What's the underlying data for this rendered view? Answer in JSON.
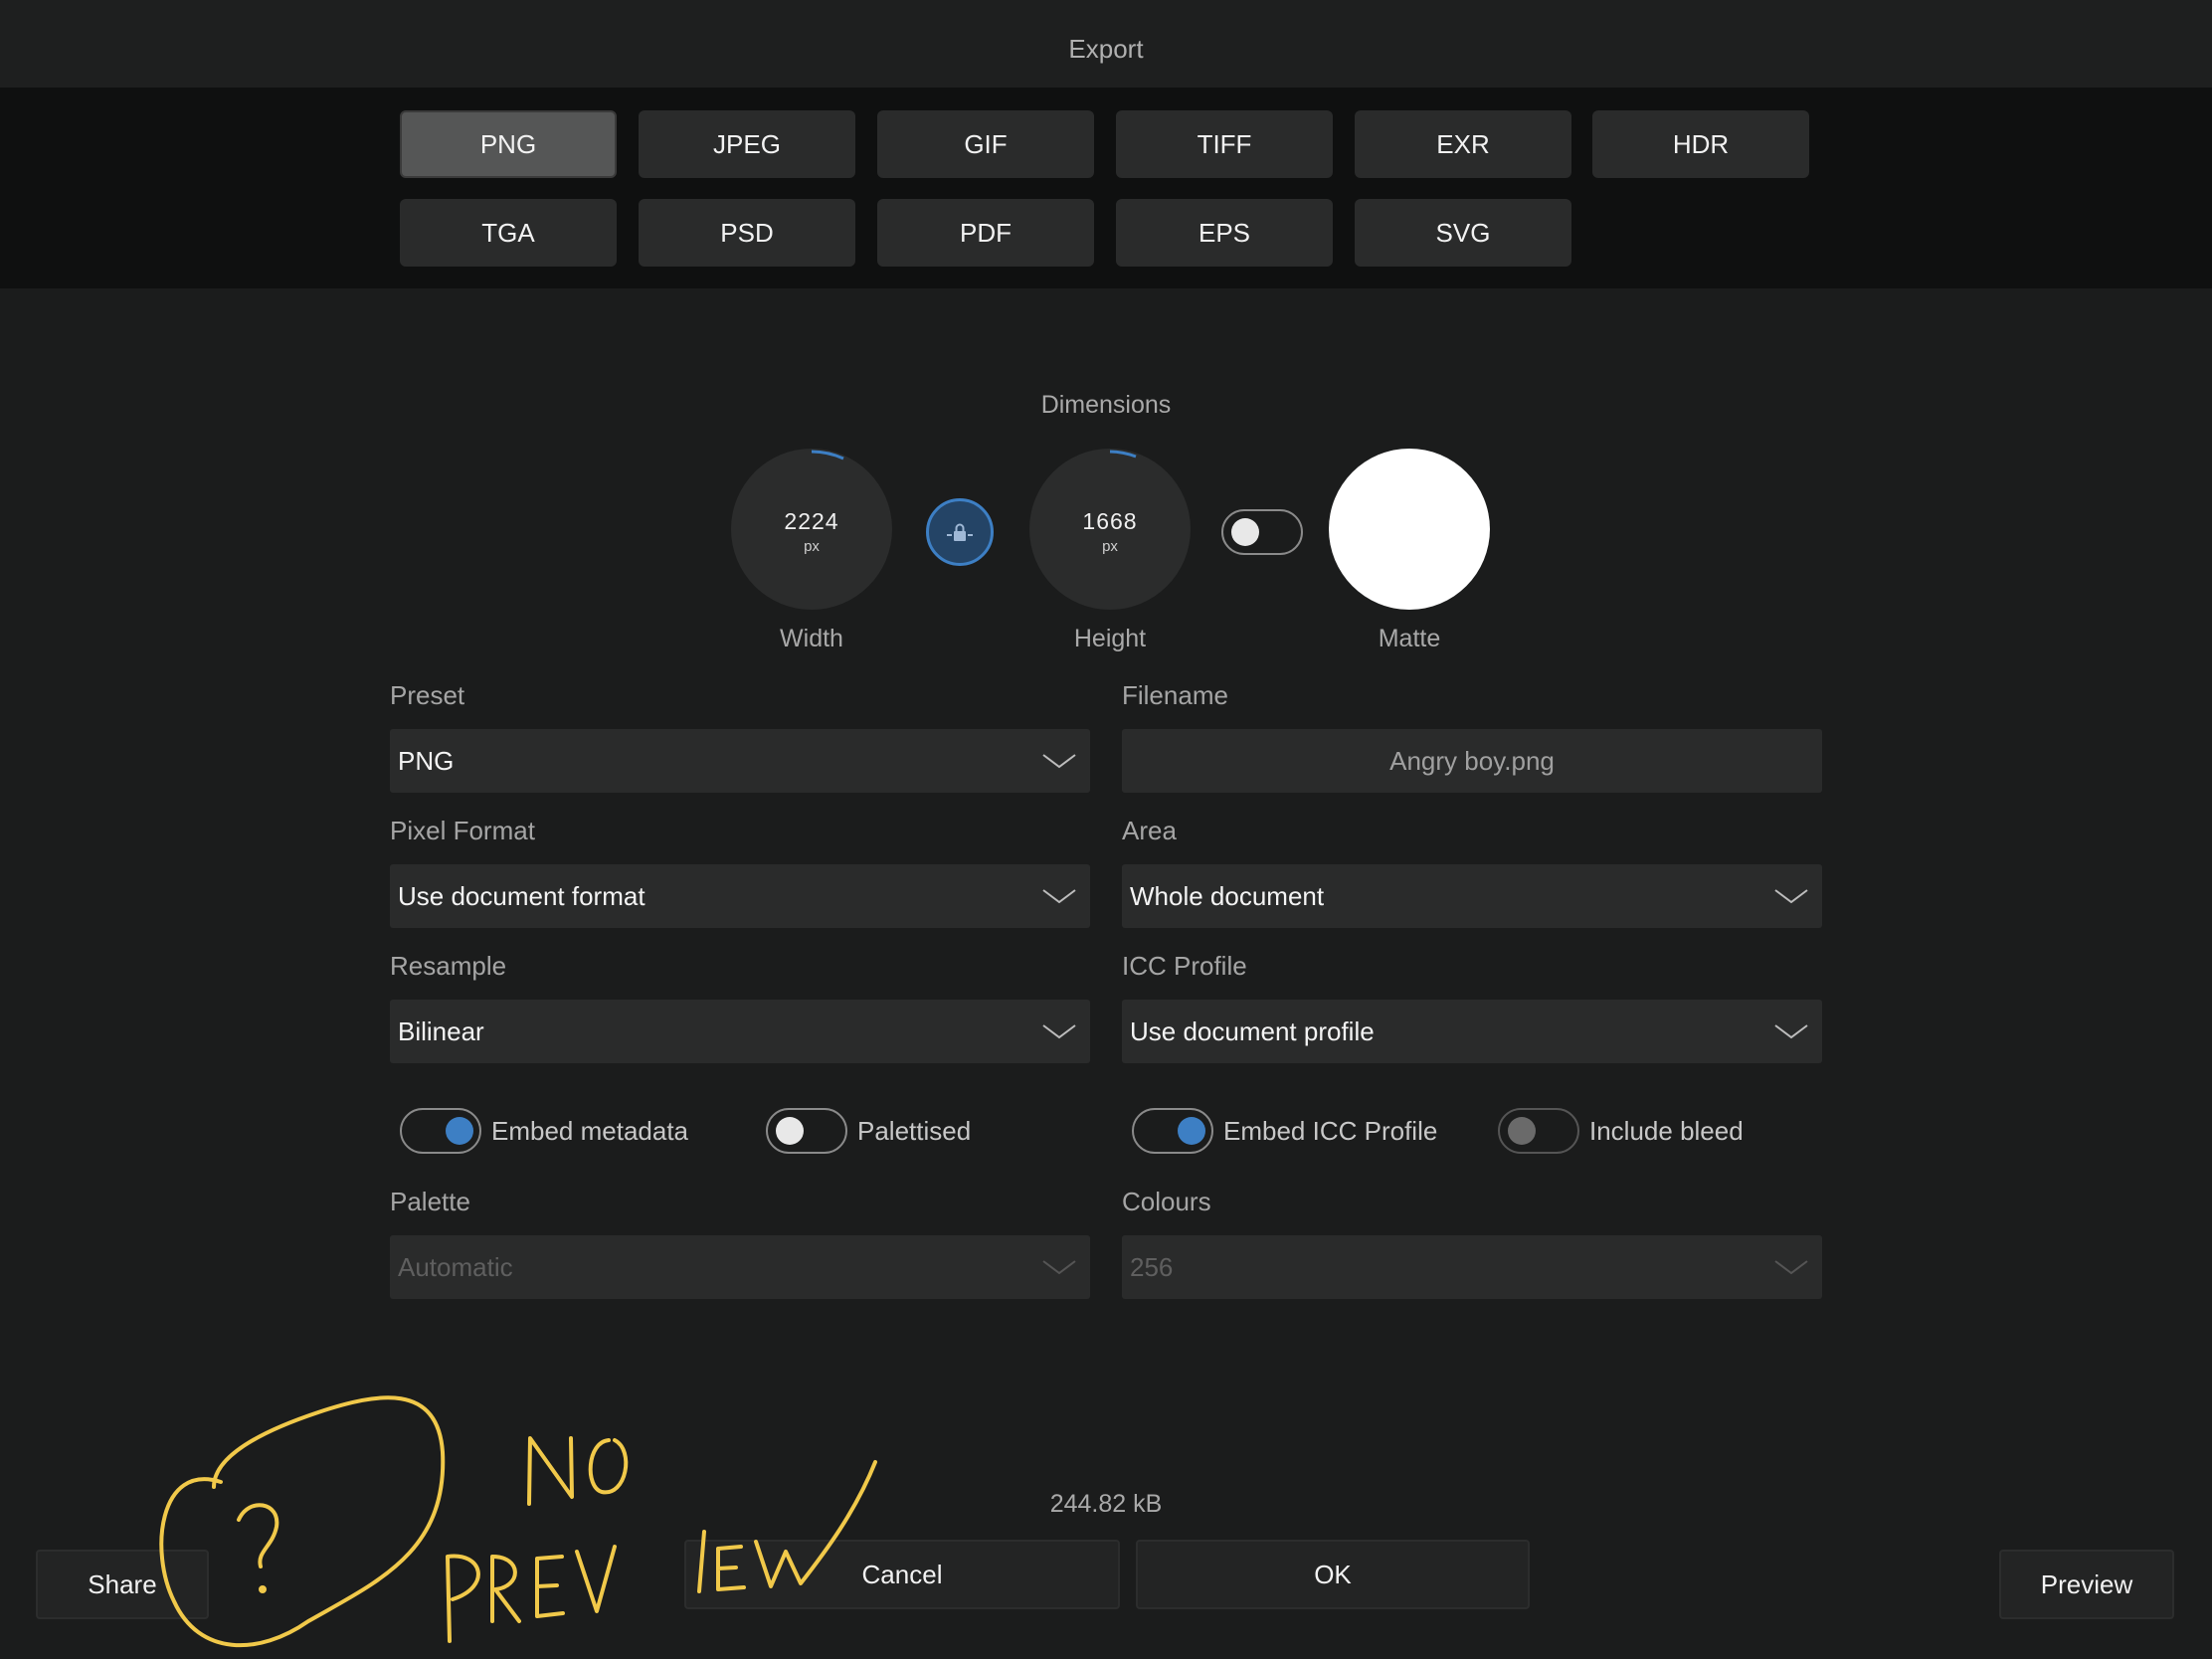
{
  "header": {
    "title": "Export"
  },
  "formats": {
    "selected": "PNG",
    "row1": [
      "PNG",
      "JPEG",
      "GIF",
      "TIFF",
      "EXR",
      "HDR"
    ],
    "row2": [
      "TGA",
      "PSD",
      "PDF",
      "EPS",
      "SVG"
    ]
  },
  "dimensions": {
    "title": "Dimensions",
    "width": {
      "value": "2224",
      "unit": "px",
      "label": "Width"
    },
    "height": {
      "value": "1668",
      "unit": "px",
      "label": "Height"
    },
    "matte": {
      "label": "Matte",
      "color": "#ffffff"
    },
    "lock_icon": "lock-icon"
  },
  "fields": {
    "preset": {
      "label": "Preset",
      "value": "PNG"
    },
    "filename": {
      "label": "Filename",
      "value": "Angry boy.png"
    },
    "pixel_format": {
      "label": "Pixel Format",
      "value": "Use document format"
    },
    "area": {
      "label": "Area",
      "value": "Whole document"
    },
    "resample": {
      "label": "Resample",
      "value": "Bilinear"
    },
    "icc_profile": {
      "label": "ICC Profile",
      "value": "Use document profile"
    },
    "palette": {
      "label": "Palette",
      "value": "Automatic"
    },
    "colours": {
      "label": "Colours",
      "value": "256"
    }
  },
  "toggles": {
    "embed_metadata": {
      "label": "Embed metadata",
      "on": true
    },
    "palettised": {
      "label": "Palettised",
      "on": false
    },
    "embed_icc": {
      "label": "Embed ICC Profile",
      "on": true
    },
    "include_bleed": {
      "label": "Include bleed",
      "on": false
    }
  },
  "footer": {
    "file_size": "244.82 kB",
    "share": "Share",
    "cancel": "Cancel",
    "ok": "OK",
    "preview": "Preview"
  },
  "annotation": {
    "text": "NO PREVIEW",
    "mark": "?"
  },
  "colors": {
    "accent": "#3d7fc4",
    "annotation": "#f1c94a"
  }
}
